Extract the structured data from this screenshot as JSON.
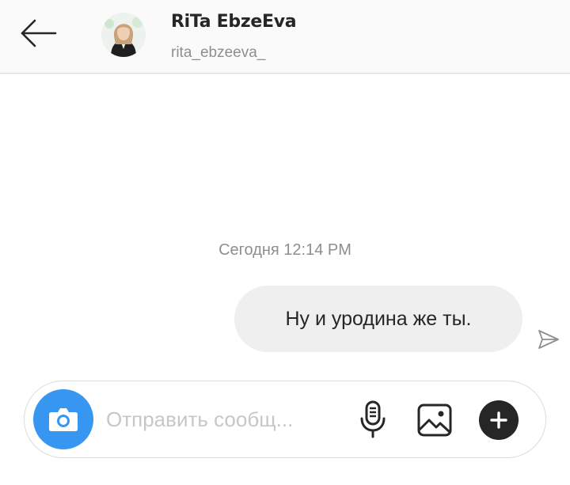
{
  "header": {
    "user_name": "RiTa EbzeEva",
    "username": "rita_ebzeeva_"
  },
  "thread": {
    "timestamp": "Сегодня 12:14 PM",
    "messages": [
      {
        "text": "Ну и уродина же ты.",
        "direction": "outgoing"
      }
    ]
  },
  "composer": {
    "placeholder": "Отправить сообщ..."
  },
  "colors": {
    "accent": "#3797f0",
    "header_bg": "#fafafa",
    "bubble_bg": "#efefef",
    "muted_text": "#8e8e8e",
    "primary_text": "#262626"
  },
  "icons": {
    "back": "arrow-left-icon",
    "avatar": "profile-photo",
    "sent_status": "paper-plane-icon",
    "camera": "camera-icon",
    "microphone": "microphone-icon",
    "gallery": "image-icon",
    "more": "plus-icon"
  }
}
